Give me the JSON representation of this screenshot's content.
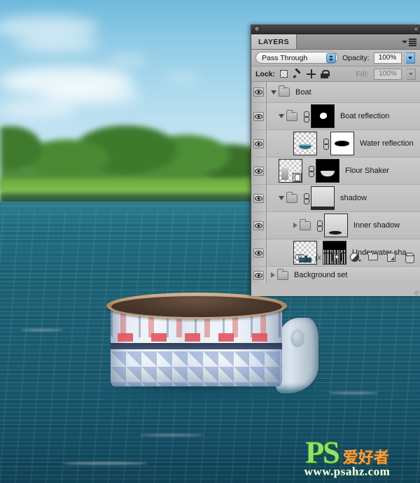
{
  "window": {
    "title_bar": {
      "close_label": "",
      "collapse_label": "«"
    }
  },
  "panel": {
    "tab_label": "LAYERS",
    "blend": {
      "mode": "Pass Through",
      "opacity_label": "Opacity:",
      "opacity_value": "100%"
    },
    "lock": {
      "label": "Lock:",
      "icons": [
        "lock-transparency-icon",
        "lock-image-icon",
        "lock-position-icon",
        "lock-all-icon"
      ],
      "fill_label": "Fill:",
      "fill_value": "100%"
    },
    "layers": [
      {
        "name": "Boat",
        "indent": 0,
        "visible": true,
        "disclosure": "down",
        "kind": "group",
        "thumb": "none",
        "linked": false
      },
      {
        "name": "Boat reflection",
        "indent": 1,
        "visible": true,
        "disclosure": "down",
        "kind": "group",
        "thumb": "mask-black-blob",
        "linked": true
      },
      {
        "name": "Water reflection",
        "indent": 2,
        "visible": true,
        "disclosure": "none",
        "kind": "layer",
        "thumb": "boat-transparent",
        "mask": "white-black-blob",
        "linked": true
      },
      {
        "name": "Flour Shaker",
        "indent": 1,
        "visible": true,
        "disclosure": "none",
        "kind": "smart-object",
        "thumb": "shaker-transparent",
        "mask": "black-white-bowl",
        "linked": true
      },
      {
        "name": "shadow",
        "indent": 1,
        "visible": true,
        "disclosure": "down",
        "kind": "group",
        "thumb": "grey-gradient",
        "linked": true
      },
      {
        "name": "Inner shadow",
        "indent": 2,
        "visible": true,
        "disclosure": "right",
        "kind": "group",
        "thumb": "grey-smudge",
        "linked": true
      },
      {
        "name": "Underwater sha...",
        "indent": 2,
        "visible": true,
        "disclosure": "none",
        "kind": "layer",
        "thumb": "underwater-transparent",
        "mask": "noise-black",
        "linked": false
      },
      {
        "name": "Background set",
        "indent": 0,
        "visible": true,
        "disclosure": "right",
        "kind": "group",
        "thumb": "none",
        "linked": false
      }
    ],
    "bottom_bar": [
      {
        "icon": "link-layers-icon",
        "label": ""
      },
      {
        "icon": "layer-style-fx-icon",
        "label": "fx"
      },
      {
        "icon": "add-layer-mask-icon",
        "label": ""
      },
      {
        "icon": "new-adjustment-layer-icon",
        "label": ""
      },
      {
        "icon": "new-group-icon",
        "label": ""
      },
      {
        "icon": "new-layer-icon",
        "label": ""
      },
      {
        "icon": "delete-layer-icon",
        "label": ""
      }
    ]
  },
  "watermark": {
    "ps": "PS",
    "cn": "爱好者",
    "url": "www.psahz.com"
  },
  "colors": {
    "panel_bg": "#bebebe",
    "row_bg": "#c4c4c4",
    "accent_blue": "#5f9fd4",
    "water": "#1b5d72",
    "sky": "#a9d8ec",
    "foliage": "#4b8a33"
  }
}
